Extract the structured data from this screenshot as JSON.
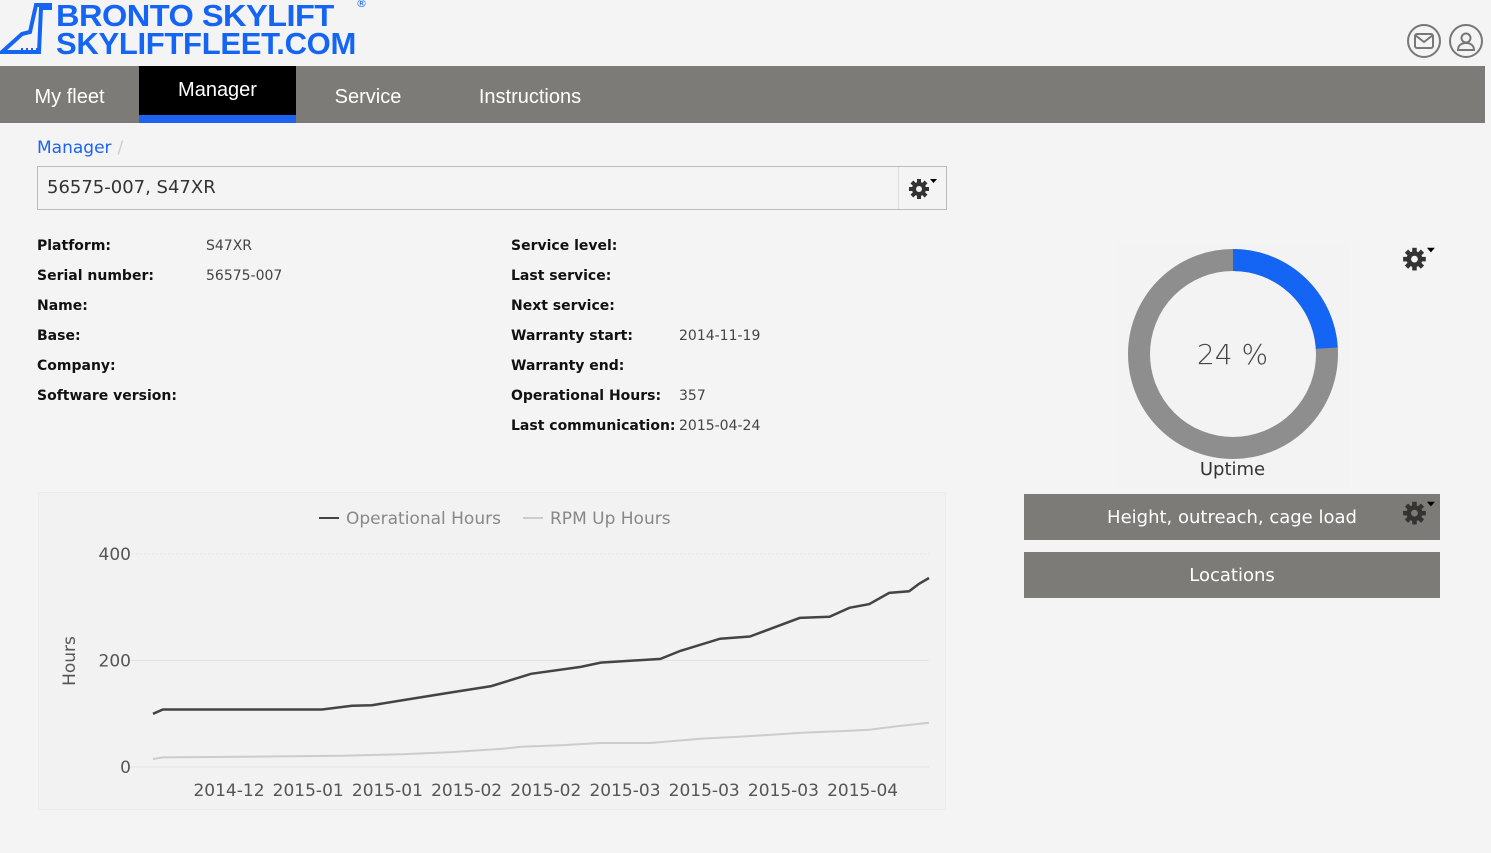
{
  "brand": {
    "line1": "BRONTO SKYLIFT",
    "line2": "SKYLIFTFLEET.COM",
    "registered": "®",
    "color": "#1565f5"
  },
  "header": {
    "icons": [
      "mail-icon",
      "user-icon"
    ]
  },
  "nav": {
    "tabs": [
      {
        "label": "My fleet",
        "active": false
      },
      {
        "label": "Manager",
        "active": true
      },
      {
        "label": "Service",
        "active": false
      },
      {
        "label": "Instructions",
        "active": false
      }
    ],
    "accent": "#1c63f0"
  },
  "breadcrumb": {
    "current": "Manager",
    "separator": "/"
  },
  "selector": {
    "value": "56575-007, S47XR"
  },
  "details_left": [
    {
      "label": "Platform:",
      "value": "S47XR"
    },
    {
      "label": "Serial number:",
      "value": "56575-007"
    },
    {
      "label": "Name:",
      "value": ""
    },
    {
      "label": "Base:",
      "value": ""
    },
    {
      "label": "Company:",
      "value": ""
    },
    {
      "label": "Software version:",
      "value": ""
    }
  ],
  "details_right": [
    {
      "label": "Service level:",
      "value": ""
    },
    {
      "label": "Last service:",
      "value": ""
    },
    {
      "label": "Next service:",
      "value": ""
    },
    {
      "label": "Warranty start:",
      "value": "2014-11-19"
    },
    {
      "label": "Warranty end:",
      "value": ""
    },
    {
      "label": "Operational Hours:",
      "value": "357"
    },
    {
      "label": "Last communication:",
      "value": "2015-04-24"
    }
  ],
  "uptime": {
    "value_text": "24 %",
    "percent": 24,
    "label": "Uptime",
    "fill_color": "#1565f5",
    "track_color": "#8e8e8e"
  },
  "buttons": {
    "height": "Height, outreach, cage load",
    "locations": "Locations"
  },
  "chart_data": {
    "type": "line",
    "ylabel": "Hours",
    "ylim": [
      0,
      400
    ],
    "yticks": [
      0,
      200,
      400
    ],
    "xlim": [
      "2014-11-19",
      "2015-04-24"
    ],
    "xtick_labels": [
      "2014-12",
      "2015-01",
      "2015-01",
      "2015-02",
      "2015-02",
      "2015-03",
      "2015-03",
      "2015-03",
      "2015-04"
    ],
    "grid": true,
    "legend": "top-center",
    "series": [
      {
        "name": "Operational Hours",
        "color": "#444444",
        "points": [
          [
            "2014-11-19",
            100
          ],
          [
            "2014-11-21",
            108
          ],
          [
            "2014-12-23",
            108
          ],
          [
            "2014-12-29",
            115
          ],
          [
            "2015-01-02",
            116
          ],
          [
            "2015-01-08",
            125
          ],
          [
            "2015-01-18",
            140
          ],
          [
            "2015-01-26",
            152
          ],
          [
            "2015-02-03",
            175
          ],
          [
            "2015-02-13",
            188
          ],
          [
            "2015-02-17",
            196
          ],
          [
            "2015-03-01",
            203
          ],
          [
            "2015-03-05",
            218
          ],
          [
            "2015-03-13",
            241
          ],
          [
            "2015-03-19",
            245
          ],
          [
            "2015-03-29",
            280
          ],
          [
            "2015-04-04",
            282
          ],
          [
            "2015-04-08",
            299
          ],
          [
            "2015-04-12",
            306
          ],
          [
            "2015-04-16",
            327
          ],
          [
            "2015-04-20",
            330
          ],
          [
            "2015-04-22",
            344
          ],
          [
            "2015-04-24",
            355
          ]
        ]
      },
      {
        "name": "RPM Up Hours",
        "color": "#cccccc",
        "points": [
          [
            "2014-11-19",
            15
          ],
          [
            "2014-11-21",
            18
          ],
          [
            "2014-12-27",
            21
          ],
          [
            "2015-01-08",
            24
          ],
          [
            "2015-01-18",
            28
          ],
          [
            "2015-01-28",
            34
          ],
          [
            "2015-02-01",
            38
          ],
          [
            "2015-02-09",
            41
          ],
          [
            "2015-02-17",
            45
          ],
          [
            "2015-02-27",
            45
          ],
          [
            "2015-03-09",
            53
          ],
          [
            "2015-03-19",
            58
          ],
          [
            "2015-03-29",
            64
          ],
          [
            "2015-04-08",
            68
          ],
          [
            "2015-04-12",
            70
          ],
          [
            "2015-04-18",
            77
          ],
          [
            "2015-04-24",
            83
          ]
        ]
      }
    ]
  }
}
